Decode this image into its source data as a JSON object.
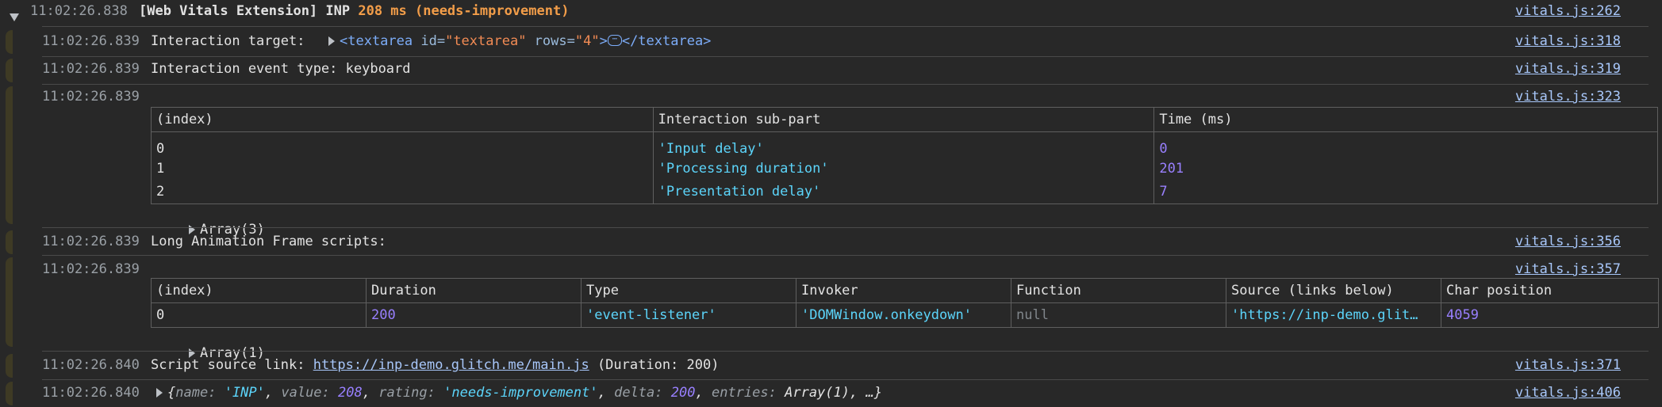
{
  "group_header": {
    "timestamp": "11:02:26.838",
    "prefix": "[Web Vitals Extension] INP ",
    "value_text": "208 ms (needs-improvement)",
    "source": "vitals.js:262"
  },
  "messages": {
    "target": {
      "timestamp": "11:02:26.839",
      "label": "Interaction target: ",
      "element": {
        "open_tag": "<textarea",
        "attr1_name": " id=",
        "attr1_value": "\"textarea\"",
        "attr2_name": " rows=",
        "attr2_value": "\"4\"",
        "close_bracket": ">",
        "ellipsis": "⋯",
        "close_tag": "</textarea>"
      },
      "source": "vitals.js:318"
    },
    "event_type": {
      "timestamp": "11:02:26.839",
      "text": "Interaction event type: keyboard",
      "source": "vitals.js:319"
    },
    "subparts_table": {
      "timestamp": "11:02:26.839",
      "source": "vitals.js:323",
      "headers": [
        "(index)",
        "Interaction sub-part",
        "Time (ms)"
      ],
      "rows": [
        [
          "0",
          "'Input delay'",
          "0"
        ],
        [
          "1",
          "'Processing duration'",
          "201"
        ],
        [
          "2",
          "'Presentation delay'",
          "7"
        ]
      ],
      "array_label": "Array(3)"
    },
    "loaf_label": {
      "timestamp": "11:02:26.839",
      "text": "Long Animation Frame scripts:",
      "source": "vitals.js:356"
    },
    "loaf_table": {
      "timestamp": "11:02:26.839",
      "source": "vitals.js:357",
      "headers": [
        "(index)",
        "Duration",
        "Type",
        "Invoker",
        "Function",
        "Source (links below)",
        "Char position"
      ],
      "rows": [
        [
          "0",
          "200",
          "'event-listener'",
          "'DOMWindow.onkeydown'",
          "null",
          "'https://inp-demo.glit…",
          "4059"
        ]
      ],
      "array_label": "Array(1)"
    },
    "script_link": {
      "timestamp": "11:02:26.840",
      "label": "Script source link: ",
      "url": "https://inp-demo.glitch.me/main.js",
      "suffix": " (Duration: 200)",
      "source": "vitals.js:371"
    },
    "object_summary": {
      "timestamp": "11:02:26.840",
      "open": "{",
      "k1": "name",
      "v1": "'INP'",
      "k2": "value",
      "v2": "208",
      "k3": "rating",
      "v3": "'needs-improvement'",
      "k4": "delta",
      "v4": "200",
      "k5": "entries",
      "v5": "Array(1)",
      "close": ", …}",
      "source": "vitals.js:406"
    }
  },
  "colors": {
    "background": "#282828",
    "warning_orange": "#f29d49",
    "string_cyan": "#5cd5fb",
    "number_purple": "#9980ff",
    "link_blue": "#a8c7fa"
  }
}
